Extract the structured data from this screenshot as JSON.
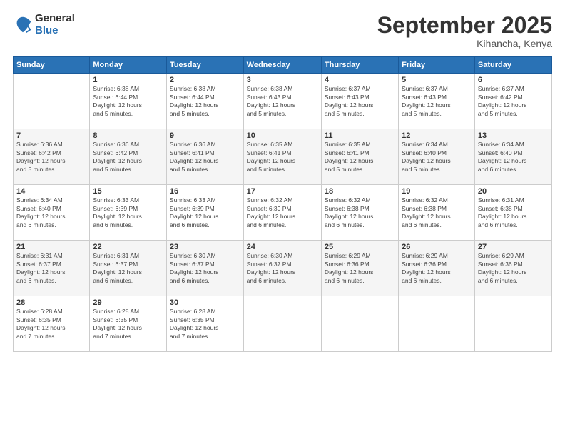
{
  "logo": {
    "general": "General",
    "blue": "Blue"
  },
  "title": "September 2025",
  "location": "Kihancha, Kenya",
  "days": [
    "Sunday",
    "Monday",
    "Tuesday",
    "Wednesday",
    "Thursday",
    "Friday",
    "Saturday"
  ],
  "weeks": [
    [
      {
        "day": "",
        "info": ""
      },
      {
        "day": "1",
        "info": "Sunrise: 6:38 AM\nSunset: 6:44 PM\nDaylight: 12 hours\nand 5 minutes."
      },
      {
        "day": "2",
        "info": "Sunrise: 6:38 AM\nSunset: 6:44 PM\nDaylight: 12 hours\nand 5 minutes."
      },
      {
        "day": "3",
        "info": "Sunrise: 6:38 AM\nSunset: 6:43 PM\nDaylight: 12 hours\nand 5 minutes."
      },
      {
        "day": "4",
        "info": "Sunrise: 6:37 AM\nSunset: 6:43 PM\nDaylight: 12 hours\nand 5 minutes."
      },
      {
        "day": "5",
        "info": "Sunrise: 6:37 AM\nSunset: 6:43 PM\nDaylight: 12 hours\nand 5 minutes."
      },
      {
        "day": "6",
        "info": "Sunrise: 6:37 AM\nSunset: 6:42 PM\nDaylight: 12 hours\nand 5 minutes."
      }
    ],
    [
      {
        "day": "7",
        "info": "Sunrise: 6:36 AM\nSunset: 6:42 PM\nDaylight: 12 hours\nand 5 minutes."
      },
      {
        "day": "8",
        "info": "Sunrise: 6:36 AM\nSunset: 6:42 PM\nDaylight: 12 hours\nand 5 minutes."
      },
      {
        "day": "9",
        "info": "Sunrise: 6:36 AM\nSunset: 6:41 PM\nDaylight: 12 hours\nand 5 minutes."
      },
      {
        "day": "10",
        "info": "Sunrise: 6:35 AM\nSunset: 6:41 PM\nDaylight: 12 hours\nand 5 minutes."
      },
      {
        "day": "11",
        "info": "Sunrise: 6:35 AM\nSunset: 6:41 PM\nDaylight: 12 hours\nand 5 minutes."
      },
      {
        "day": "12",
        "info": "Sunrise: 6:34 AM\nSunset: 6:40 PM\nDaylight: 12 hours\nand 5 minutes."
      },
      {
        "day": "13",
        "info": "Sunrise: 6:34 AM\nSunset: 6:40 PM\nDaylight: 12 hours\nand 6 minutes."
      }
    ],
    [
      {
        "day": "14",
        "info": "Sunrise: 6:34 AM\nSunset: 6:40 PM\nDaylight: 12 hours\nand 6 minutes."
      },
      {
        "day": "15",
        "info": "Sunrise: 6:33 AM\nSunset: 6:39 PM\nDaylight: 12 hours\nand 6 minutes."
      },
      {
        "day": "16",
        "info": "Sunrise: 6:33 AM\nSunset: 6:39 PM\nDaylight: 12 hours\nand 6 minutes."
      },
      {
        "day": "17",
        "info": "Sunrise: 6:32 AM\nSunset: 6:39 PM\nDaylight: 12 hours\nand 6 minutes."
      },
      {
        "day": "18",
        "info": "Sunrise: 6:32 AM\nSunset: 6:38 PM\nDaylight: 12 hours\nand 6 minutes."
      },
      {
        "day": "19",
        "info": "Sunrise: 6:32 AM\nSunset: 6:38 PM\nDaylight: 12 hours\nand 6 minutes."
      },
      {
        "day": "20",
        "info": "Sunrise: 6:31 AM\nSunset: 6:38 PM\nDaylight: 12 hours\nand 6 minutes."
      }
    ],
    [
      {
        "day": "21",
        "info": "Sunrise: 6:31 AM\nSunset: 6:37 PM\nDaylight: 12 hours\nand 6 minutes."
      },
      {
        "day": "22",
        "info": "Sunrise: 6:31 AM\nSunset: 6:37 PM\nDaylight: 12 hours\nand 6 minutes."
      },
      {
        "day": "23",
        "info": "Sunrise: 6:30 AM\nSunset: 6:37 PM\nDaylight: 12 hours\nand 6 minutes."
      },
      {
        "day": "24",
        "info": "Sunrise: 6:30 AM\nSunset: 6:37 PM\nDaylight: 12 hours\nand 6 minutes."
      },
      {
        "day": "25",
        "info": "Sunrise: 6:29 AM\nSunset: 6:36 PM\nDaylight: 12 hours\nand 6 minutes."
      },
      {
        "day": "26",
        "info": "Sunrise: 6:29 AM\nSunset: 6:36 PM\nDaylight: 12 hours\nand 6 minutes."
      },
      {
        "day": "27",
        "info": "Sunrise: 6:29 AM\nSunset: 6:36 PM\nDaylight: 12 hours\nand 6 minutes."
      }
    ],
    [
      {
        "day": "28",
        "info": "Sunrise: 6:28 AM\nSunset: 6:35 PM\nDaylight: 12 hours\nand 7 minutes."
      },
      {
        "day": "29",
        "info": "Sunrise: 6:28 AM\nSunset: 6:35 PM\nDaylight: 12 hours\nand 7 minutes."
      },
      {
        "day": "30",
        "info": "Sunrise: 6:28 AM\nSunset: 6:35 PM\nDaylight: 12 hours\nand 7 minutes."
      },
      {
        "day": "",
        "info": ""
      },
      {
        "day": "",
        "info": ""
      },
      {
        "day": "",
        "info": ""
      },
      {
        "day": "",
        "info": ""
      }
    ]
  ]
}
